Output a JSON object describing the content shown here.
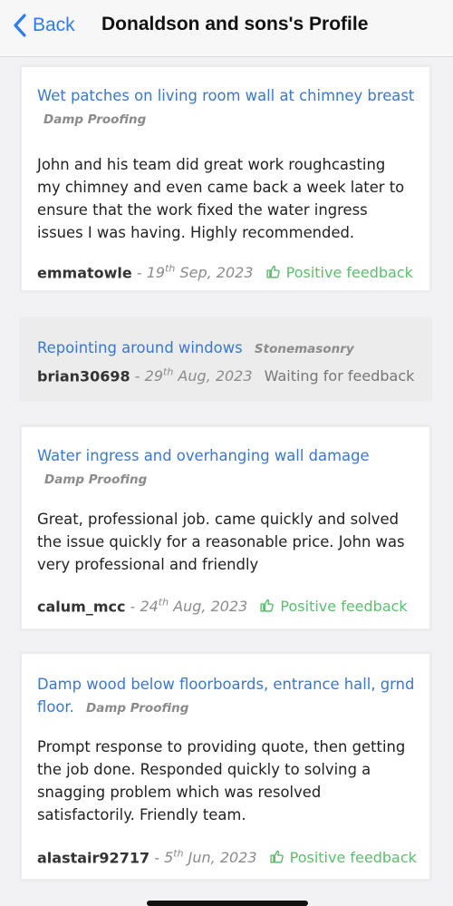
{
  "nav": {
    "back_label": "Back",
    "title": "Donaldson and sons's Profile"
  },
  "reviews": [
    {
      "title": "Wet patches on living room wall at chimney breast",
      "category": "Damp Proofing",
      "text": "John and his team did great work roughcasting my chimney and even came back a week later to ensure that the work fixed the water ingress issues I was having. Highly recommended.",
      "user": "emmatowle",
      "separator": "-",
      "date_day": "19",
      "date_suffix": "th",
      "date_rest": "Sep, 2023",
      "status": "Positive feedback"
    },
    {
      "title": "Repointing around windows",
      "category": "Stonemasonry",
      "user": "brian30698",
      "separator": "-",
      "date_day": "29",
      "date_suffix": "th",
      "date_rest": "Aug, 2023",
      "status": "Waiting for feedback"
    },
    {
      "title": "Water ingress and overhanging wall damage",
      "category": "Damp Proofing",
      "text": "Great, professional job. came quickly and solved the issue quickly for a reasonable price. John was very professional and friendly",
      "user": "calum_mcc",
      "separator": "-",
      "date_day": "24",
      "date_suffix": "th",
      "date_rest": "Aug, 2023",
      "status": "Positive feedback"
    },
    {
      "title": "Damp wood below floorboards, entrance hall, grnd floor.",
      "category": "Damp Proofing",
      "text": "Prompt response to providing quote, then getting the job done. Responded quickly to solving a snagging problem which was resolved satisfactorily. Friendly team.",
      "user": "alastair92717",
      "separator": "-",
      "date_day": "5",
      "date_suffix": "th",
      "date_rest": "Jun, 2023",
      "status": "Positive feedback"
    }
  ],
  "colors": {
    "accent": "#3a78cf",
    "back": "#2f7bf5",
    "positive": "#5cbf6e"
  },
  "icons": {
    "back": "chevron-left-icon",
    "positive": "thumbs-up-icon"
  }
}
